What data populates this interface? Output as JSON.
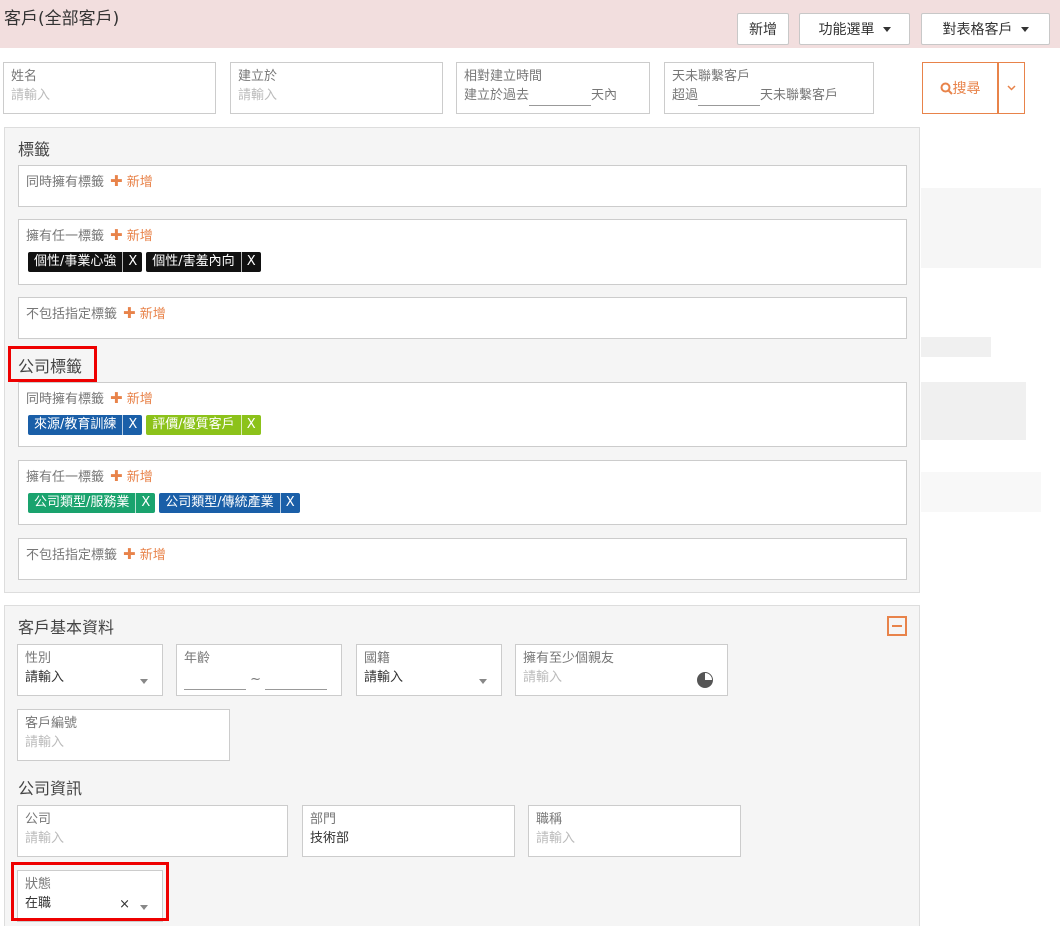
{
  "header": {
    "title": "客戶(全部客戶)",
    "new_label": "新增",
    "func_menu_label": "功能選單",
    "table_customer_label": "對表格客戶"
  },
  "filters": {
    "name": {
      "label": "姓名",
      "placeholder": "請輸入"
    },
    "created": {
      "label": "建立於",
      "placeholder": "請輸入"
    },
    "relative": {
      "label": "相對建立時間",
      "prefix": "建立於過去",
      "suffix": "天內"
    },
    "no_contact": {
      "label": "天未聯繫客戶",
      "prefix": "超過",
      "suffix": "天未聯繫客戶"
    },
    "search_label": "搜尋"
  },
  "tags_section": {
    "title": "標籤",
    "all_label": "同時擁有標籤",
    "any_label": "擁有任一標籤",
    "exclude_label": "不包括指定標籤",
    "add_label": "新增",
    "any_tags": [
      {
        "text": "個性/事業心強",
        "x": "X",
        "color": "#111111"
      },
      {
        "text": "個性/害羞內向",
        "x": "X",
        "color": "#111111"
      }
    ]
  },
  "company_tags_section": {
    "title": "公司標籤",
    "all_label": "同時擁有標籤",
    "any_label": "擁有任一標籤",
    "exclude_label": "不包括指定標籤",
    "add_label": "新增",
    "all_tags": [
      {
        "text": "來源/教育訓練",
        "x": "X",
        "color": "#1a5fa8"
      },
      {
        "text": "評價/優質客戶",
        "x": "X",
        "color": "#8cc21a"
      }
    ],
    "any_tags": [
      {
        "text": "公司類型/服務業",
        "x": "X",
        "color": "#1aa36e"
      },
      {
        "text": "公司類型/傳統產業",
        "x": "X",
        "color": "#1a5fa8"
      }
    ]
  },
  "basic_section": {
    "title": "客戶基本資料",
    "gender": {
      "label": "性別",
      "value": "請輸入"
    },
    "age": {
      "label": "年齡",
      "sep": "~"
    },
    "nationality": {
      "label": "國籍",
      "value": "請輸入"
    },
    "friends": {
      "label": "擁有至少個親友",
      "placeholder": "請輸入"
    },
    "customer_no": {
      "label": "客戶編號",
      "placeholder": "請輸入"
    }
  },
  "company_section": {
    "title": "公司資訊",
    "company": {
      "label": "公司",
      "placeholder": "請輸入"
    },
    "department": {
      "label": "部門",
      "value": "技術部"
    },
    "job_title": {
      "label": "職稱",
      "placeholder": "請輸入"
    },
    "status": {
      "label": "狀態",
      "value": "在職",
      "clear": "×"
    }
  }
}
